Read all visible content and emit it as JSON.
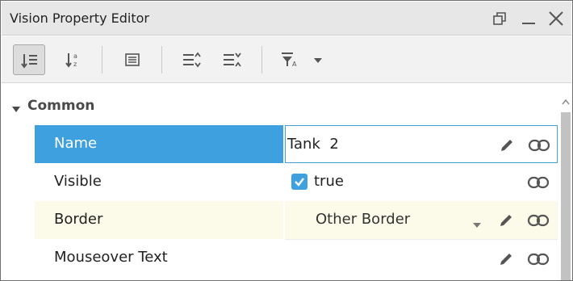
{
  "window": {
    "title": "Vision Property Editor"
  },
  "toolbar": {
    "buttons": [
      {
        "icon": "sort-categorized-icon",
        "selected": true
      },
      {
        "icon": "sort-alphabetical-icon",
        "selected": false
      },
      {
        "icon": "property-list-icon",
        "selected": false
      },
      {
        "icon": "expand-all-icon",
        "selected": false
      },
      {
        "icon": "collapse-all-icon",
        "selected": false
      },
      {
        "icon": "filter-icon",
        "selected": false
      },
      {
        "icon": "filter-dropdown-icon",
        "selected": false
      }
    ]
  },
  "section": {
    "label": "Common"
  },
  "properties": {
    "name": {
      "label": "Name",
      "value": "Tank  2"
    },
    "visible": {
      "label": "Visible",
      "value": "true",
      "checked": true
    },
    "border": {
      "label": "Border",
      "value": "Other Border"
    },
    "mouseover": {
      "label": "Mouseover Text",
      "value": ""
    }
  },
  "colors": {
    "selection": "#3ea0de",
    "highlight_row": "#fcfbe9",
    "icon": "#555555"
  }
}
